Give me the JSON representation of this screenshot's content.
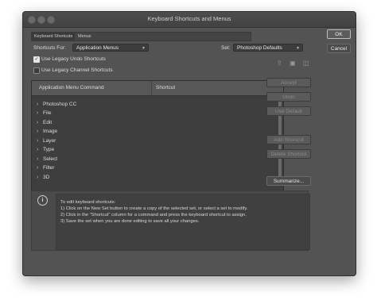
{
  "window": {
    "title": "Keyboard Shortcuts and Menus"
  },
  "tabs": [
    "Keyboard Shortcuts",
    "Menus"
  ],
  "shortcuts_for": {
    "label": "Shortcuts For:",
    "value": "Application Menus"
  },
  "set": {
    "label": "Set:",
    "value": "Photoshop Defaults"
  },
  "options": {
    "legacy_undo": {
      "label": "Use Legacy Undo Shortcuts",
      "checked": true
    },
    "legacy_channel": {
      "label": "Use Legacy Channel Shortcuts",
      "checked": false
    }
  },
  "table": {
    "col_command": "Application Menu Command",
    "col_shortcut": "Shortcut",
    "rows": [
      "Photoshop CC",
      "File",
      "Edit",
      "Image",
      "Layer",
      "Type",
      "Select",
      "Filter",
      "3D"
    ]
  },
  "buttons": {
    "ok": "OK",
    "cancel": "Cancel",
    "accept": "Accept",
    "undo": "Undo",
    "use_default": "Use Default",
    "add_shortcut": "Add Shortcut",
    "delete_shortcut": "Delete Shortcut",
    "summarize": "Summarize..."
  },
  "icons": {
    "save_set": "save-set-icon",
    "new_set": "new-set-icon",
    "delete_set": "trash-icon"
  },
  "info": {
    "lines": [
      "To edit keyboard shortcuts:",
      "1) Click on the New Set button to create a copy of the selected set, or select a set to modify.",
      "2) Click in the \"Shortcut\" column for a command and press the keyboard shortcut to assign.",
      "3) Save the set when you are done editing to save all your changes."
    ]
  }
}
